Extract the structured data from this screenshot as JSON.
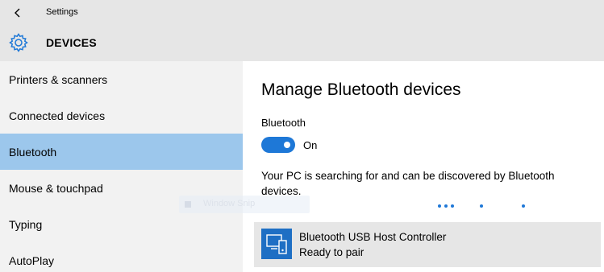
{
  "header": {
    "app_title": "Settings",
    "section_title": "DEVICES"
  },
  "sidebar": {
    "items": [
      {
        "label": "Printers & scanners",
        "selected": false
      },
      {
        "label": "Connected devices",
        "selected": false
      },
      {
        "label": "Bluetooth",
        "selected": true
      },
      {
        "label": "Mouse & touchpad",
        "selected": false
      },
      {
        "label": "Typing",
        "selected": false
      },
      {
        "label": "AutoPlay",
        "selected": false
      }
    ]
  },
  "main": {
    "title": "Manage Bluetooth devices",
    "bluetooth_label": "Bluetooth",
    "toggle_state": "On",
    "description": "Your PC is searching for and can be discovered by Bluetooth devices.",
    "device": {
      "name": "Bluetooth USB Host Controller",
      "status": "Ready to pair"
    }
  },
  "overlay": {
    "snip_text": "Window Snip"
  },
  "colors": {
    "accent": "#1e78d7",
    "selected_nav": "#9cc7ec",
    "sidebar_bg": "#f2f2f2",
    "header_bg": "#e6e6e6"
  },
  "icons": [
    "back-arrow-icon",
    "gear-icon",
    "device-icon"
  ]
}
